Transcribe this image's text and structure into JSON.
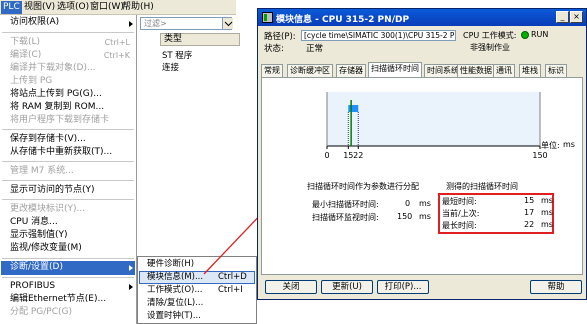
{
  "menubar": {
    "items": [
      {
        "label": "PLC",
        "active": true
      },
      {
        "label": "视图(V)"
      },
      {
        "label": "选项(O)"
      },
      {
        "label": "窗口(W)"
      },
      {
        "label": "帮助(H)"
      }
    ]
  },
  "plc_menu": {
    "access_rights": "访问权限(A)",
    "download": "下载(L)",
    "download_sc": "Ctrl+L",
    "upload": "编译(C)",
    "upload_sc": "Ctrl+K",
    "compile_all": "编译并下载对象(D)...",
    "upload_station": "上传到 PG",
    "upload_to_pg": "将站点上传到 PG(G)...",
    "copy_ram": "将 RAM 复制到 ROM...",
    "download_user": "将用户程序下载到存储卡",
    "save_card": "保存到存储卡(V)...",
    "retrieve_card": "从存储卡中重新获取(T)...",
    "manage_m7": "管理 M7 系统...",
    "display_nodes": "显示可访问的节点(Y)",
    "change_id": "更改模块标识(Y)...",
    "cpu_msg": "CPU 消息...",
    "display_force": "显示强制值(Y)",
    "monitor_modify": "监视/修改变量(M)",
    "diag_setting": "诊断/设置(D)",
    "profibus": "PROFIBUS",
    "edit_ethernet": "编辑Ethernet节点(E)...",
    "assign_pgpc": "分配 PG/PC(G)"
  },
  "bg_window": {
    "filter_placeholder": "过滤>",
    "col_type": "类型",
    "row1": "ST 程序",
    "row2": "连接"
  },
  "submenu": {
    "items": [
      {
        "label": "硬件诊断(H)",
        "shortcut": ""
      },
      {
        "label": "模块信息(M)...",
        "shortcut": "Ctrl+D",
        "highlight": true
      },
      {
        "label": "工作模式(O)...",
        "shortcut": "Ctrl+I"
      },
      {
        "label": "清除/复位(L)...",
        "shortcut": ""
      },
      {
        "label": "设置时钟(T)...",
        "shortcut": ""
      }
    ]
  },
  "dialog": {
    "title": "模块信息 - CPU 315-2 PN/DP",
    "path_label": "路径(P):",
    "path_value": "[cycle time\\SIMATIC 300(1)\\CPU 315-2 PN/DP",
    "status_label": "状态:",
    "status_value": "正常",
    "cpu_mode_label": "CPU 工作模式:",
    "cpu_mode_value": "RUN",
    "forced_value": "非强制作业",
    "tabs": [
      "常规",
      "诊断缓冲区",
      "存储器",
      "扫描循环时间",
      "时间系统",
      "性能数据",
      "通讯",
      "堆栈",
      "标识"
    ],
    "selected_tab": 3,
    "unit_label": "单位:",
    "unit_value": "ms",
    "axis_ticks": [
      "0",
      "15",
      "22",
      "150"
    ],
    "left_group_title": "扫描循环时间作为参数进行分配",
    "min_cycle_label": "最小扫描循环时间:",
    "min_cycle_value": "0",
    "min_cycle_unit": "ms",
    "watch_cycle_label": "扫描循环监视时间:",
    "watch_cycle_value": "150",
    "watch_cycle_unit": "ms",
    "right_group_title": "测得的扫描循环时间",
    "shortest_label": "最短时间:",
    "shortest_value": "15",
    "current_label": "当前/上次:",
    "current_value": "17",
    "longest_label": "最长时间:",
    "longest_value": "22",
    "ms": "ms",
    "btn_close": "关闭",
    "btn_update": "更新(U)",
    "btn_print": "打印(P)...",
    "btn_help": "帮助"
  },
  "chart_data": {
    "type": "bar",
    "x_range": [
      0,
      150
    ],
    "shortest": 15,
    "current": 17,
    "longest": 22,
    "ticks": [
      0,
      15,
      22,
      150
    ],
    "unit": "ms"
  },
  "colors": {
    "titlebar": "#0a3cb8",
    "highlight": "#316ac5",
    "range_bar": "#1e90ff",
    "current_line": "#008000",
    "red_box": "#e02020",
    "arrow": "#e02020"
  }
}
